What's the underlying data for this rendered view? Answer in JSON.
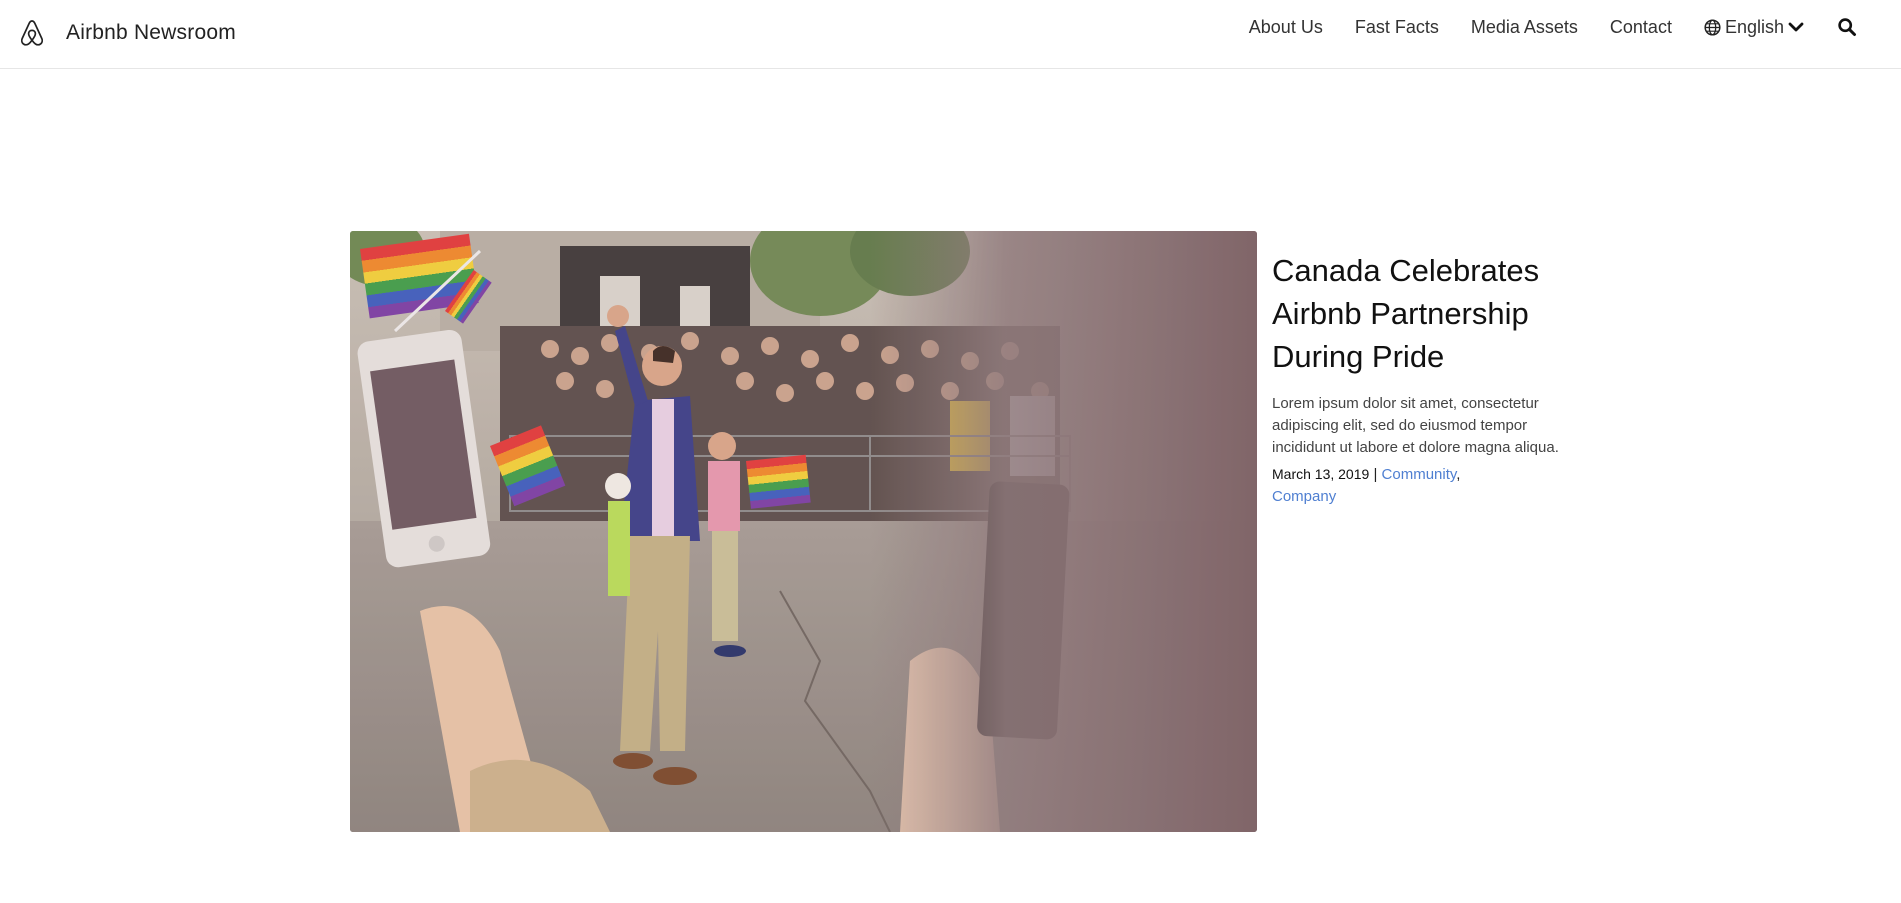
{
  "header": {
    "brand_name": "Airbnb Newsroom",
    "logo_icon": "airbnb-belo-icon",
    "nav": [
      "About Us",
      "Fast Facts",
      "Media Assets",
      "Contact"
    ],
    "language": "English",
    "language_icons": [
      "globe-icon",
      "chevron-down-icon"
    ],
    "search_icon": "search-icon"
  },
  "article": {
    "title": "Canada Celebrates Airbnb Partnership During Pride",
    "excerpt": "Lorem ipsum dolor sit amet, consectetur adipiscing elit, sed do eiusmod tempor incididunt ut labore et dolore magna aliqua.",
    "date": "March 13, 2019",
    "separator": " | ",
    "categories": [
      "Community",
      "Company"
    ],
    "category_joiner": ","
  },
  "colors": {
    "link": "#4f7fd1",
    "text": "#222222",
    "border": "#e6e6e6"
  }
}
